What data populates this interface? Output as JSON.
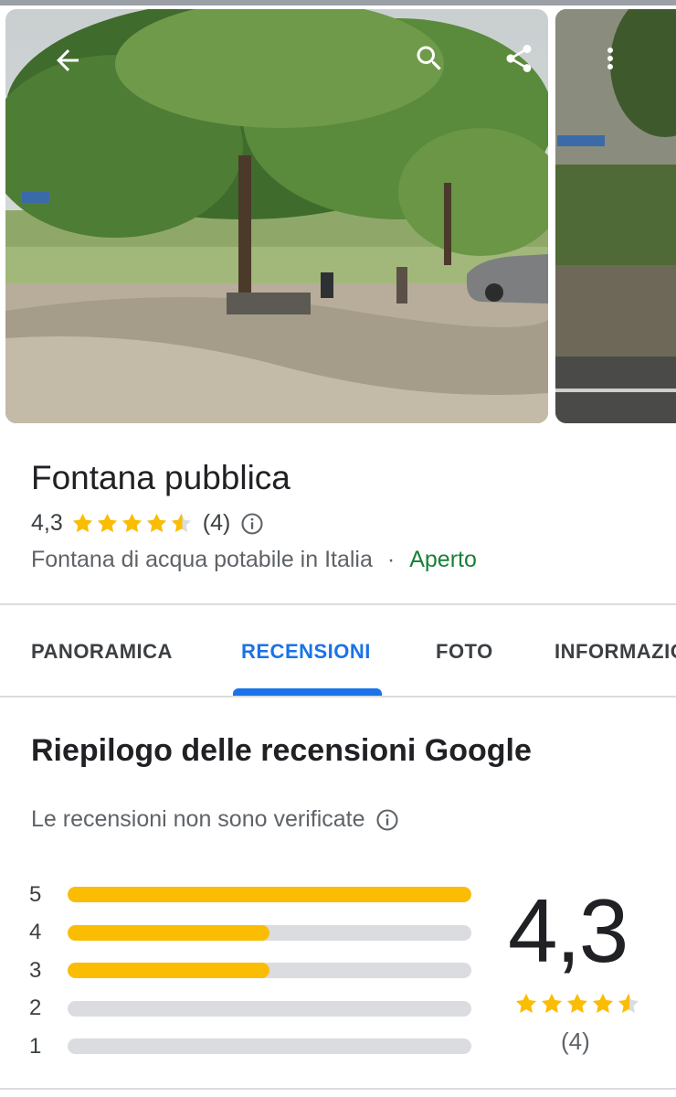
{
  "place": {
    "name": "Fontana pubblica",
    "rating": "4,3",
    "rating_value": 4.3,
    "review_count": "(4)",
    "category": "Fontana di acqua potabile in Italia",
    "separator": "·",
    "status": "Aperto"
  },
  "tabs": [
    {
      "label": "PANORAMICA",
      "active": false
    },
    {
      "label": "RECENSIONI",
      "active": true
    },
    {
      "label": "FOTO",
      "active": false
    },
    {
      "label": "INFORMAZIONI",
      "active": false
    }
  ],
  "reviews": {
    "title": "Riepilogo delle recensioni Google",
    "note": "Le recensioni non sono verificate",
    "average": "4,3",
    "average_value": 4.3,
    "count": "(4)",
    "distribution": [
      {
        "stars": "5",
        "fraction": 1.0
      },
      {
        "stars": "4",
        "fraction": 0.5
      },
      {
        "stars": "3",
        "fraction": 0.5
      },
      {
        "stars": "2",
        "fraction": 0.0
      },
      {
        "stars": "1",
        "fraction": 0.0
      }
    ]
  },
  "icons": {
    "back": "arrow-back-icon",
    "search": "search-icon",
    "share": "share-icon",
    "more": "more-vert-icon",
    "info": "info-icon",
    "star": "star-icon"
  },
  "colors": {
    "accent": "#1a73e8",
    "star": "#fbbc04",
    "open": "#188038",
    "track": "#dadce0"
  }
}
